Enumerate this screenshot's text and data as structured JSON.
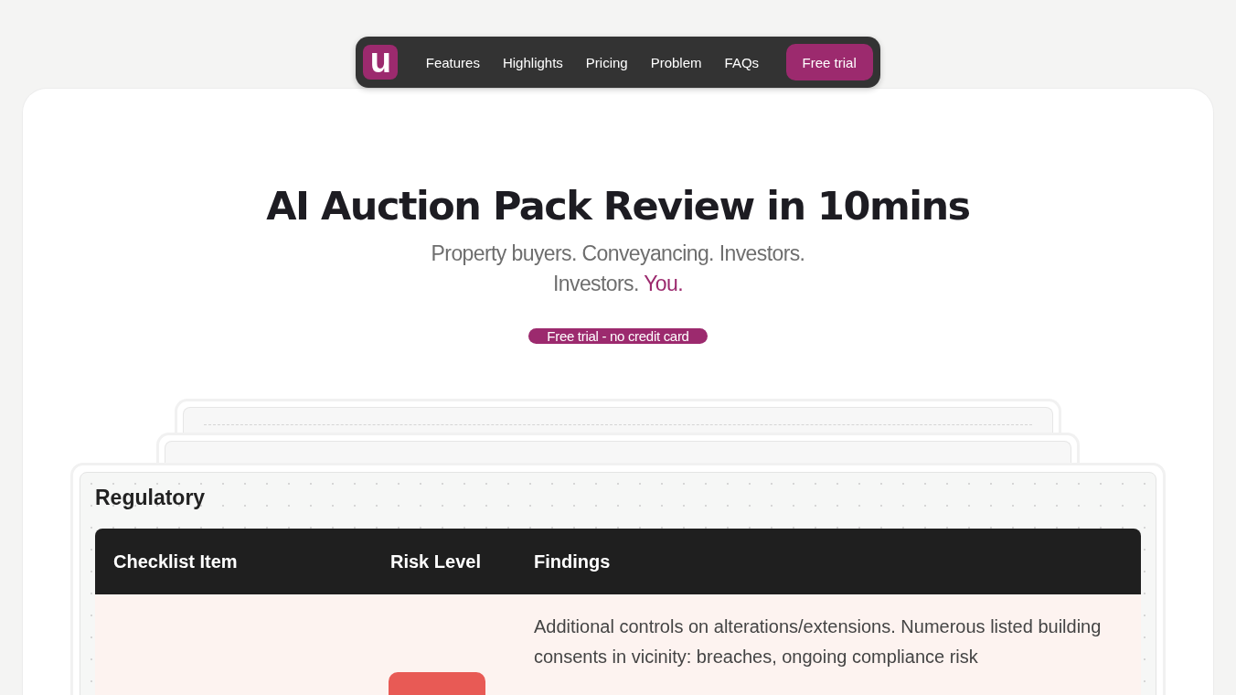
{
  "nav": {
    "logo": "u",
    "links": [
      "Features",
      "Highlights",
      "Pricing",
      "Problem",
      "FAQs"
    ],
    "cta": "Free trial"
  },
  "hero": {
    "title": "AI Auction Pack Review in 10mins",
    "subtitle_line_1": "Property buyers. Conveyancing. Investors.",
    "subtitle_line_2": "Investors.",
    "subtitle_accent": "You.",
    "cta": "Free trial - no credit card"
  },
  "report": {
    "section_title": "Regulatory",
    "table": {
      "columns": [
        "Checklist Item",
        "Risk Level",
        "Findings"
      ],
      "rows": [
        {
          "findings": "Additional controls on alterations/extensions. Numerous listed building consents in vicinity: breaches, ongoing compliance risk"
        }
      ]
    }
  }
}
